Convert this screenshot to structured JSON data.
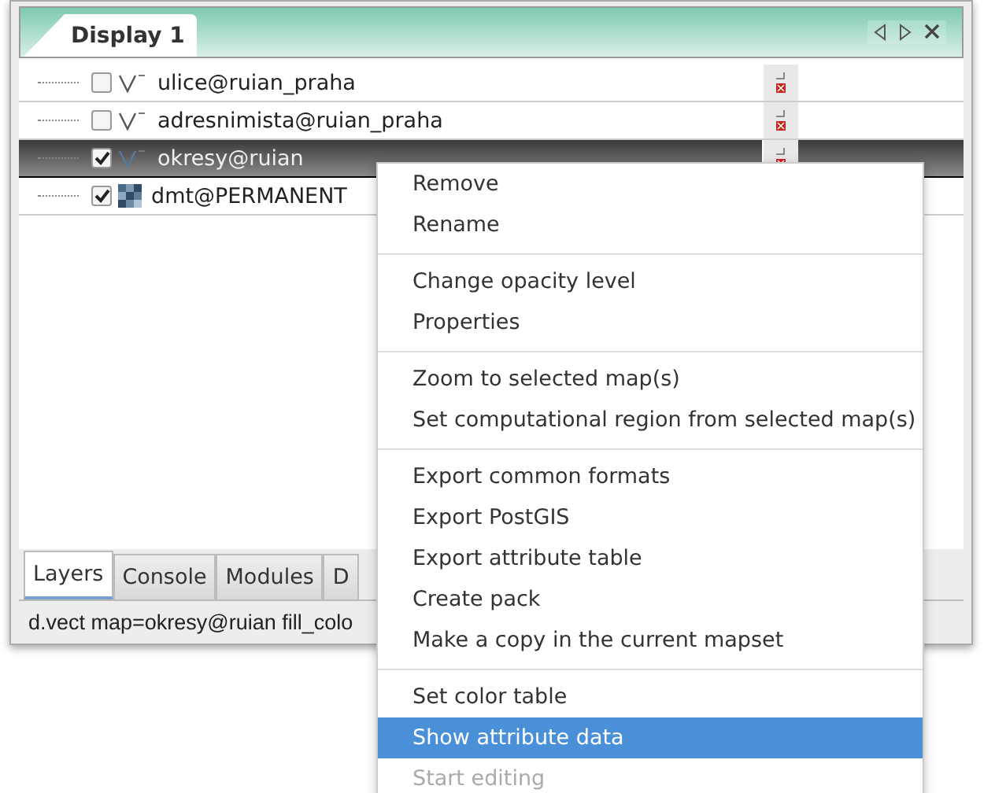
{
  "display_tab": {
    "label": "Display 1",
    "selected": true
  },
  "layers": [
    {
      "name": "ulice@ruian_praha",
      "kind": "vector",
      "checked": false,
      "selected": false
    },
    {
      "name": "adresnimista@ruian_praha",
      "kind": "vector",
      "checked": false,
      "selected": false
    },
    {
      "name": "okresy@ruian",
      "kind": "vector",
      "checked": true,
      "selected": true
    },
    {
      "name": "dmt@PERMANENT",
      "kind": "raster",
      "checked": true,
      "selected": false
    }
  ],
  "bottom_tabs": [
    {
      "label": "Layers",
      "selected": true
    },
    {
      "label": "Console",
      "selected": false
    },
    {
      "label": "Modules",
      "selected": false
    },
    {
      "label": "D",
      "selected": false
    }
  ],
  "status_bar": "d.vect map=okresy@ruian fill_colo",
  "context_menu": [
    {
      "kind": "item",
      "label": "Remove",
      "selected": false,
      "disabled": false
    },
    {
      "kind": "item",
      "label": "Rename",
      "selected": false,
      "disabled": false
    },
    {
      "kind": "separator"
    },
    {
      "kind": "item",
      "label": "Change opacity level",
      "selected": false,
      "disabled": false
    },
    {
      "kind": "item",
      "label": "Properties",
      "selected": false,
      "disabled": false
    },
    {
      "kind": "separator"
    },
    {
      "kind": "item",
      "label": "Zoom to selected map(s)",
      "selected": false,
      "disabled": false
    },
    {
      "kind": "item",
      "label": "Set computational region from selected map(s)",
      "selected": false,
      "disabled": false
    },
    {
      "kind": "separator"
    },
    {
      "kind": "item",
      "label": "Export common formats",
      "selected": false,
      "disabled": false
    },
    {
      "kind": "item",
      "label": "Export PostGIS",
      "selected": false,
      "disabled": false
    },
    {
      "kind": "item",
      "label": "Export attribute table",
      "selected": false,
      "disabled": false
    },
    {
      "kind": "item",
      "label": "Create pack",
      "selected": false,
      "disabled": false
    },
    {
      "kind": "item",
      "label": "Make a copy in the current mapset",
      "selected": false,
      "disabled": false
    },
    {
      "kind": "separator"
    },
    {
      "kind": "item",
      "label": "Set color table",
      "selected": false,
      "disabled": false
    },
    {
      "kind": "item",
      "label": "Show attribute data",
      "selected": true,
      "disabled": false
    },
    {
      "kind": "item",
      "label": "Start editing",
      "selected": false,
      "disabled": true
    }
  ]
}
